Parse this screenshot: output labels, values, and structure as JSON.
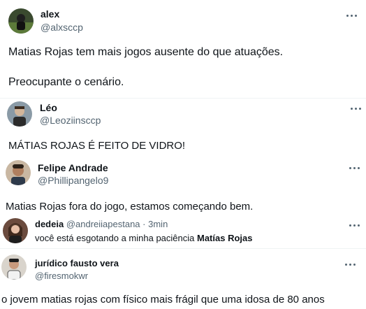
{
  "tweets": [
    {
      "name": "alex",
      "handle": "@alxsccp",
      "lines": [
        "Matias Rojas tem mais jogos ausente do que atuações.",
        "Preocupante o cenário."
      ]
    },
    {
      "name": "Léo",
      "handle": "@Leoziinsccp",
      "lines": [
        "MÁTIAS ROJAS É FEITO DE VIDRO!"
      ]
    },
    {
      "name": "Felipe Andrade",
      "handle": "@Phillipangelo9",
      "lines": [
        "Matias Rojas fora do jogo, estamos começando bem."
      ]
    },
    {
      "name": "dedeia",
      "handle": "@andreiiapestana",
      "dot": "·",
      "time": "3min",
      "text_prefix": "você está esgotando a minha paciência ",
      "text_bold": "Matías Rojas"
    },
    {
      "name": "jurídico fausto vera",
      "handle": "@firesmokwr",
      "lines": [
        "o jovem matias rojas com físico mais frágil que uma idosa de 80 anos"
      ]
    }
  ],
  "icons": {
    "more": "more-horizontal-icon"
  }
}
